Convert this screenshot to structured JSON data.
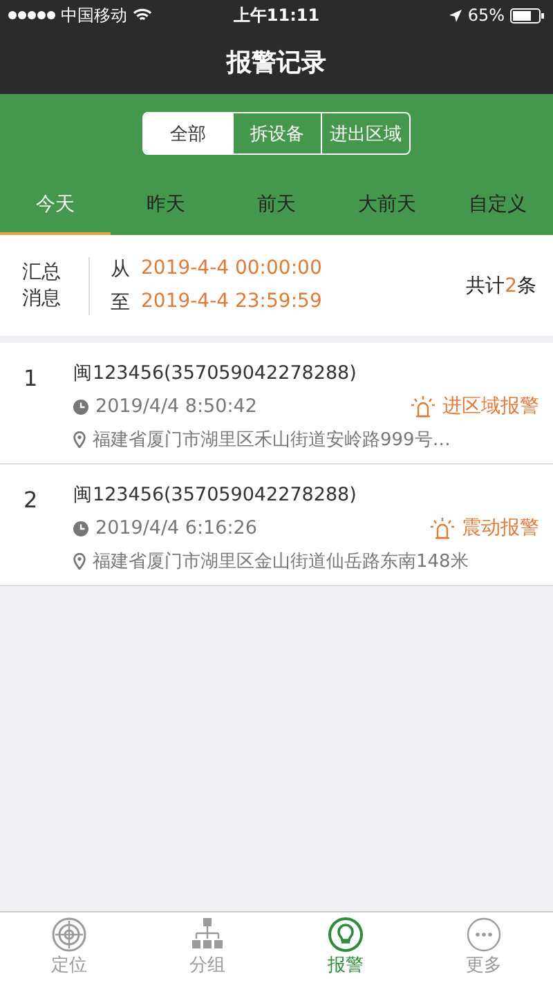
{
  "status_bar": {
    "carrier": "中国移动",
    "time": "上午11:11",
    "battery": "65%"
  },
  "title": "报警记录",
  "filters": [
    {
      "label": "全部",
      "selected": true
    },
    {
      "label": "拆设备",
      "selected": false
    },
    {
      "label": "进出区域",
      "selected": false
    }
  ],
  "days": [
    {
      "label": "今天",
      "selected": true
    },
    {
      "label": "昨天",
      "selected": false
    },
    {
      "label": "前天",
      "selected": false
    },
    {
      "label": "大前天",
      "selected": false
    },
    {
      "label": "自定义",
      "selected": false
    }
  ],
  "summary": {
    "label": "汇总消息",
    "from_label": "从",
    "from": "2019-4-4 00:00:00",
    "to_label": "至",
    "to": "2019-4-4 23:59:59",
    "total_prefix": "共计",
    "total_count": "2",
    "total_suffix": "条"
  },
  "records": [
    {
      "index": "1",
      "device": "闽123456(357059042278288)",
      "time": "2019/4/4 8:50:42",
      "alarm": "进区域报警",
      "address": "福建省厦门市湖里区禾山街道安岭路999号…"
    },
    {
      "index": "2",
      "device": "闽123456(357059042278288)",
      "time": "2019/4/4 6:16:26",
      "alarm": "震动报警",
      "address": "福建省厦门市湖里区金山街道仙岳路东南148米"
    }
  ],
  "tab_bar": [
    {
      "kind": "locate",
      "label": "定位",
      "selected": false
    },
    {
      "kind": "group",
      "label": "分组",
      "selected": false
    },
    {
      "kind": "alarm",
      "label": "报警",
      "selected": true
    },
    {
      "kind": "more",
      "label": "更多",
      "selected": false
    }
  ]
}
